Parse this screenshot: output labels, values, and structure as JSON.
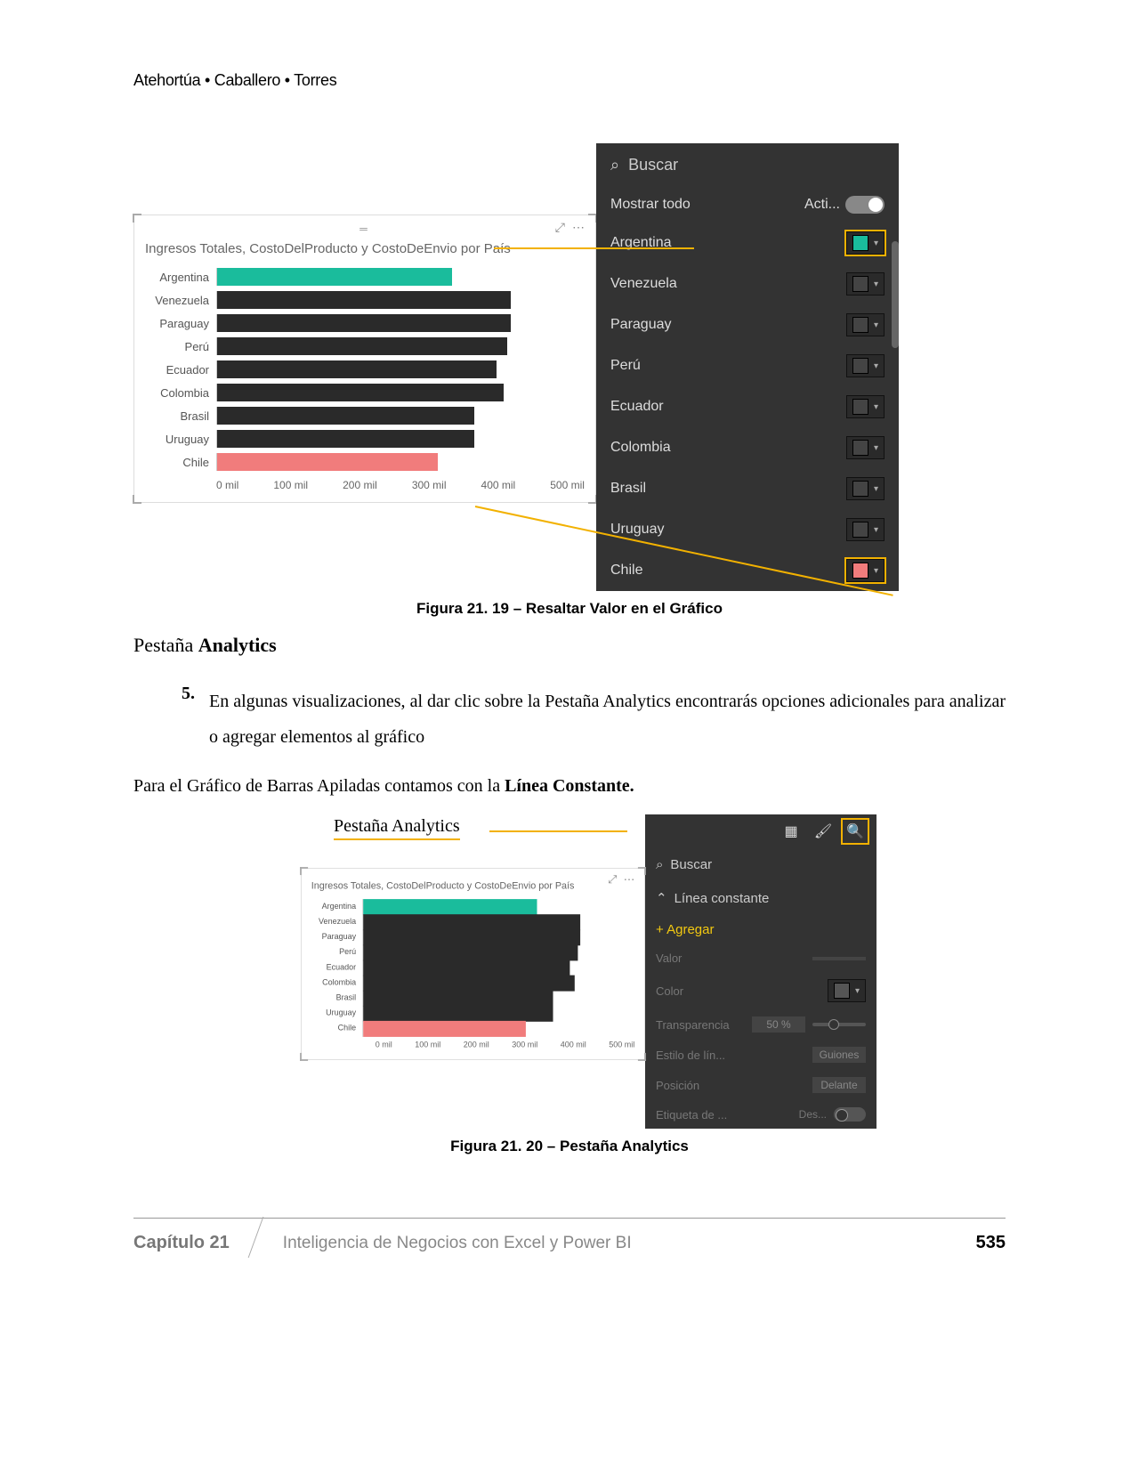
{
  "header": "Atehortúa • Caballero • Torres",
  "chart_data": {
    "type": "bar",
    "orientation": "horizontal",
    "title": "Ingresos Totales, CostoDelProducto y CostoDeEnvio por País",
    "xlabel": "",
    "ylabel": "",
    "xlim": [
      0,
      500
    ],
    "x_ticks": [
      "0 mil",
      "100 mil",
      "200 mil",
      "300 mil",
      "400 mil",
      "500 mil"
    ],
    "categories": [
      "Argentina",
      "Venezuela",
      "Paraguay",
      "Perú",
      "Ecuador",
      "Colombia",
      "Brasil",
      "Uruguay",
      "Chile"
    ],
    "values": [
      320,
      400,
      400,
      395,
      380,
      390,
      350,
      350,
      300
    ],
    "colors": [
      "#1abc9c",
      "#2a2a2a",
      "#2a2a2a",
      "#2a2a2a",
      "#2a2a2a",
      "#2a2a2a",
      "#2a2a2a",
      "#2a2a2a",
      "#f17c7c"
    ]
  },
  "format_panel": {
    "search_placeholder": "Buscar",
    "show_all_label": "Mostrar todo",
    "toggle_text": "Acti...",
    "items": [
      {
        "name": "Argentina",
        "color": "#1abc9c",
        "highlighted": true
      },
      {
        "name": "Venezuela",
        "color": "#444444",
        "highlighted": false
      },
      {
        "name": "Paraguay",
        "color": "#444444",
        "highlighted": false
      },
      {
        "name": "Perú",
        "color": "#444444",
        "highlighted": false
      },
      {
        "name": "Ecuador",
        "color": "#444444",
        "highlighted": false
      },
      {
        "name": "Colombia",
        "color": "#444444",
        "highlighted": false
      },
      {
        "name": "Brasil",
        "color": "#444444",
        "highlighted": false
      },
      {
        "name": "Uruguay",
        "color": "#444444",
        "highlighted": false
      },
      {
        "name": "Chile",
        "color": "#f17c7c",
        "highlighted": true
      }
    ]
  },
  "caption1": "Figura 21. 19 – Resaltar Valor en el Gráfico",
  "section_heading_prefix": "Pestaña ",
  "section_heading_bold": "Analytics",
  "list_num": "5.",
  "list_text": "En algunas visualizaciones, al dar clic sobre la Pestaña Analytics encontrarás opciones adicionales para analizar o agregar elementos al gráfico",
  "body_line_prefix": "Para el Gráfico de Barras Apiladas contamos con la ",
  "body_line_bold": "Línea Constante.",
  "annot_label": "Pestaña Analytics",
  "analytics_panel": {
    "search": "Buscar",
    "section": "Línea constante",
    "add": "+ Agregar",
    "rows": [
      {
        "label": "Valor",
        "control": "input",
        "value": ""
      },
      {
        "label": "Color",
        "control": "swatch"
      },
      {
        "label": "Transparencia",
        "control": "slider",
        "value": "50 %"
      },
      {
        "label": "Estilo de lín...",
        "control": "select",
        "value": "Guiones"
      },
      {
        "label": "Posición",
        "control": "select",
        "value": "Delante"
      },
      {
        "label": "Etiqueta de ...",
        "control": "toggle",
        "value": "Des..."
      }
    ]
  },
  "caption2": "Figura 21. 20 – Pestaña Analytics",
  "footer": {
    "chapter": "Capítulo 21",
    "title": "Inteligencia de Negocios con Excel y Power BI",
    "page": "535"
  }
}
